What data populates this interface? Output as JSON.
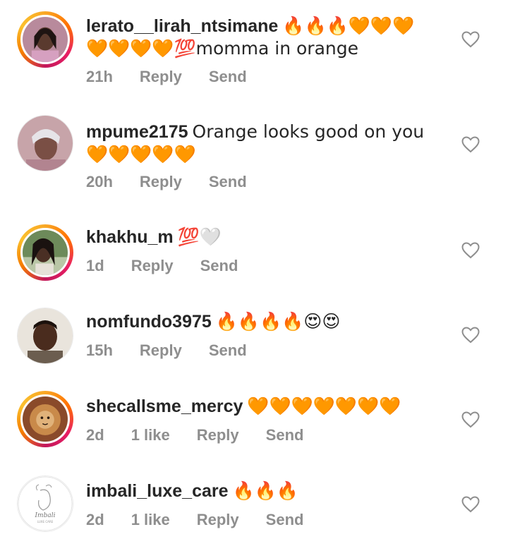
{
  "comments": [
    {
      "username": "lerato__lirah_ntsimane",
      "text": "🔥🔥🔥🧡🧡🧡🧡🧡🧡🧡💯momma in orange",
      "time": "21h",
      "likes": "",
      "reply": "Reply",
      "send": "Send"
    },
    {
      "username": "mpume2175",
      "text": "Orange looks good on you🧡🧡🧡🧡🧡",
      "time": "20h",
      "likes": "",
      "reply": "Reply",
      "send": "Send"
    },
    {
      "username": "khakhu_m",
      "text": "💯🤍",
      "time": "1d",
      "likes": "",
      "reply": "Reply",
      "send": "Send"
    },
    {
      "username": "nomfundo3975",
      "text": "🔥🔥🔥🔥😍😍",
      "time": "15h",
      "likes": "",
      "reply": "Reply",
      "send": "Send"
    },
    {
      "username": "shecallsme_mercy",
      "text": "🧡🧡🧡🧡🧡🧡🧡",
      "time": "2d",
      "likes": "1 like",
      "reply": "Reply",
      "send": "Send"
    },
    {
      "username": "imbali_luxe_care",
      "text": "🔥🔥🔥",
      "time": "2d",
      "likes": "1 like",
      "reply": "Reply",
      "send": "Send"
    }
  ],
  "icons": {
    "like": "heart-outline-icon"
  },
  "colors": {
    "text": "#262626",
    "meta": "#8e8e8e",
    "story_ring": "#e91e63"
  }
}
